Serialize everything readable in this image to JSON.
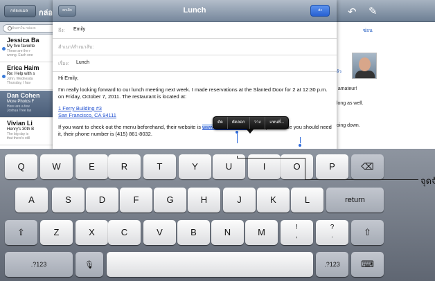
{
  "maillist": {
    "back_label": "กล่องแมล",
    "title": "กล่อ",
    "search_placeholder": "ค้นหาใน กล่องจ",
    "rows": [
      {
        "sender": "Jessica Ba",
        "subject": "My five favorite",
        "preview1": "These are the r",
        "preview2": "wrong. Each one",
        "unread": true,
        "selected": false
      },
      {
        "sender": "Erica Haim",
        "subject": "Re: Help with s",
        "preview1": "John, Wednesda",
        "preview2": "Thursday, I hav",
        "unread": true,
        "selected": false
      },
      {
        "sender": "Dan Cohen",
        "subject": "More Photos F",
        "preview1": "Here are a few",
        "preview2": "Joshua Tree las",
        "unread": false,
        "selected": true
      },
      {
        "sender": "Vivian Li",
        "subject": "Henry's 30th B",
        "preview1": "The big day is",
        "preview2": "that there's still",
        "unread": false,
        "selected": false
      }
    ]
  },
  "pane": {
    "hide_label": "ซ่อน",
    "cut_label": "แล้ว",
    "line1": "n amateur!",
    "line2": "along as well.",
    "line3": "going down."
  },
  "compose": {
    "cancel_label": "ยกเลิก",
    "title": "Lunch",
    "send_label": "ส่ง",
    "to_label": "ถึง:",
    "to_value": "Emily",
    "cc_label": "สำเนา/สำเนาลับ:",
    "subject_label": "เรื่อง:",
    "subject_value": "Lunch",
    "greeting": "Hi Emily,",
    "para1": "I'm really looking forward to our lunch meeting next week. I made reservations at the Slanted Door for 2 at 12:30 p.m. on Friday, October 7, 2011. The restaurant is located at:",
    "address1": "1 Ferry Building #3",
    "address2": "San Francisco, CA 94111",
    "para2_start": "If you want to check out the menu beforehand, their website is ",
    "url": "www.slanteddoor.com",
    "para2_end": ". And just in case you should need it, their phone number is (415) 861-8032."
  },
  "edit_menu": {
    "cut": "ตัด",
    "copy": "คัดลอก",
    "paste": "วาง",
    "replace": "แทนที่..."
  },
  "keyboard": {
    "row1": [
      "Q",
      "W",
      "E",
      "R",
      "T",
      "Y",
      "U",
      "I",
      "O",
      "P"
    ],
    "row2": [
      "A",
      "S",
      "D",
      "F",
      "G",
      "H",
      "J",
      "K",
      "L"
    ],
    "row3": [
      "Z",
      "X",
      "C",
      "V",
      "B",
      "N",
      "M"
    ],
    "return_label": "return",
    "numbers_label": ".?123",
    "excl_top": "!",
    "excl_bottom": ",",
    "quest_top": "?",
    "quest_bottom": ".",
    "shift_glyph": "⇧",
    "delete_glyph": "⌫",
    "mic_glyph": "🎙",
    "hide_glyph": "⌨"
  },
  "callout": {
    "label": "จุดจับ"
  },
  "colors": {
    "accent": "#2f6bdb",
    "toolbar": "#76879c",
    "keyboard": "#6f7682"
  }
}
